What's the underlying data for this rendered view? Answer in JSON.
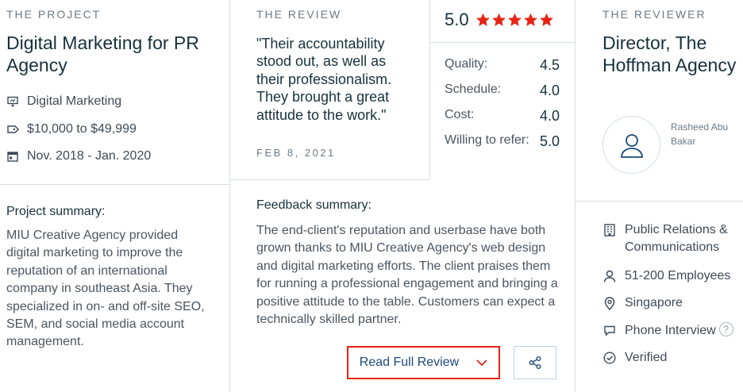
{
  "project": {
    "eyebrow": "THE PROJECT",
    "title": "Digital Marketing for PR Agency",
    "service": "Digital Marketing",
    "budget": "$10,000 to $49,999",
    "dates": "Nov. 2018 - Jan. 2020",
    "summary_heading": "Project summary:",
    "summary": "MIU Creative Agency provided digital marketing to improve the reputation of an international company in southeast Asia. They specialized in on- and off-site SEO, SEM, and social media account management."
  },
  "review": {
    "eyebrow": "THE REVIEW",
    "quote": "\"Their accountability stood out, as well as their professionalism. They brought a great attitude to the work.\"",
    "date": "FEB 8, 2021",
    "overall": "5.0",
    "overall_stars": 5,
    "ratings": [
      {
        "label": "Quality:",
        "value": "4.5"
      },
      {
        "label": "Schedule:",
        "value": "4.0"
      },
      {
        "label": "Cost:",
        "value": "4.0"
      },
      {
        "label": "Willing to refer:",
        "value": "5.0"
      }
    ],
    "feedback_heading": "Feedback summary:",
    "feedback": "The end-client's reputation and userbase have both grown thanks to MIU Creative Agency's web design and digital marketing efforts. The client praises them for running a professional engagement and bringing a positive attitude to the table. Customers can expect a technically skilled partner.",
    "read_full_label": "Read Full Review"
  },
  "reviewer": {
    "eyebrow": "THE REVIEWER",
    "title": "Director, The Hoffman Agency",
    "name": "Rasheed Abu Bakar",
    "industry": "Public Relations & Communications",
    "size": "51-200 Employees",
    "location": "Singapore",
    "interview": "Phone Interview",
    "help": "?",
    "verified": "Verified"
  },
  "colors": {
    "star": "#e62415",
    "accent_border": "#e62415",
    "link": "#1a4a7a"
  }
}
